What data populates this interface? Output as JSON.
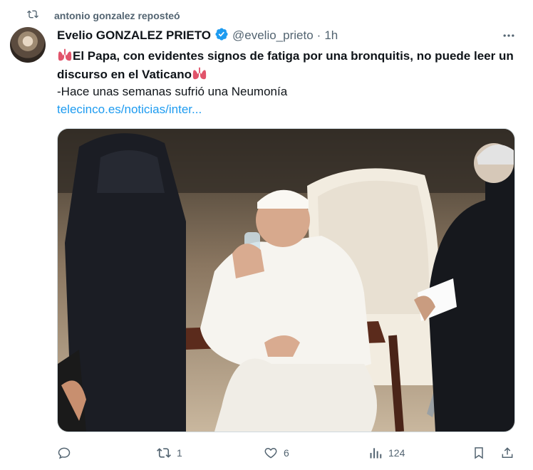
{
  "repost": {
    "text": "antonio gonzalez reposteó"
  },
  "post": {
    "author_name": "Evelio GONZALEZ PRIETO",
    "handle": "@evelio_prieto",
    "separator": "·",
    "time": "1h",
    "text_part1": "El Papa, con evidentes signos de fatiga por una bronquitis, no puede leer un discurso en el Vaticano",
    "text_line3": "-Hace unas semanas sufrió una Neumonía",
    "link": "telecinco.es/noticias/inter..."
  },
  "actions": {
    "replies": "",
    "reposts": "1",
    "likes": "6",
    "views": "124"
  },
  "colors": {
    "text": "#0f1419",
    "secondary": "#536471",
    "link": "#1d9bf0",
    "verified": "#1d9bf0"
  }
}
